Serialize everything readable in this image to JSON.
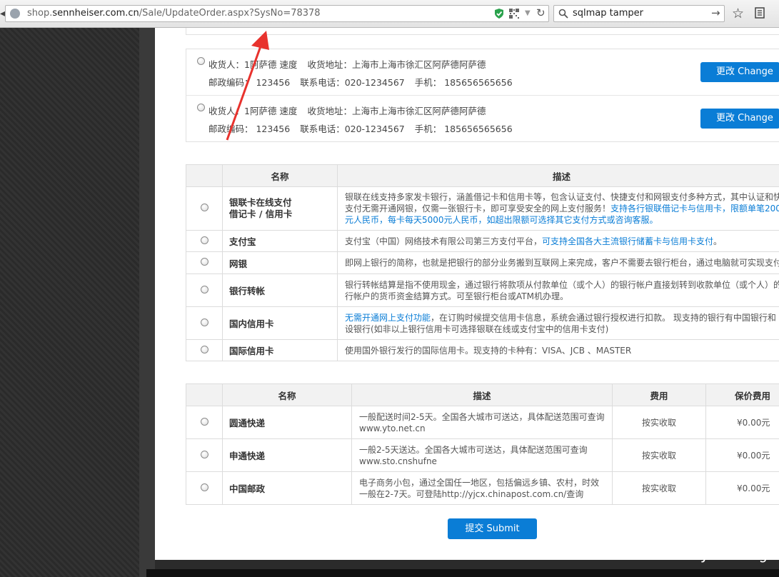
{
  "browser": {
    "url_prefix": "shop.",
    "url_domain": "sennheiser.com.cn",
    "url_path": "/Sale/UpdateOrder.aspx?SysNo=78378",
    "search_query": "sqlmap tamper"
  },
  "addresses": [
    {
      "line1_a": "收货人：1阿萨德 速度",
      "line1_b": "收货地址：上海市上海市徐汇区阿萨德阿萨德",
      "zip": "邮政编码：  123456",
      "phone": "联系电话：020-1234567",
      "mobile": "手机：  185656565656",
      "button": "更改 Change"
    },
    {
      "line1_a": "收货人：1阿萨德 速度",
      "line1_b": "收货地址：上海市上海市徐汇区阿萨德阿萨德",
      "zip": "邮政编码：  123456",
      "phone": "联系电话：020-1234567",
      "mobile": "手机：  185656565656",
      "button": "更改 Change"
    }
  ],
  "payment": {
    "headers": [
      "名称",
      "描述"
    ],
    "rows": [
      {
        "name_1": "银联卡在线支付",
        "name_2": "借记卡 / 信用卡",
        "d1": "银联在线支持多家发卡银行，涵盖借记卡和信用卡等，包含认证支付、快捷支付和网银支付多种方式，其中认证和快",
        "d2a": "支付无需开通网银，仅需一张银行卡，即可享受安全的网上支付服务！",
        "d2b": "支持各行银联借记卡与信用卡，限额单笔200",
        "d3": "元人民币，每卡每天5000元人民币，如超出限额可选择其它支付方式或咨询客服。"
      },
      {
        "name_1": "支付宝",
        "d1a": "支付宝（中国）网络技术有限公司第三方支付平台，",
        "d1b": "可支持全国各大主流银行储蓄卡与信用卡支付",
        "d1c": "。"
      },
      {
        "name_1": "网银",
        "d1": "即网上银行的简称，也就是把银行的部分业务搬到互联网上来完成，客户不需要去银行柜台，通过电脑就可实现支付"
      },
      {
        "name_1": "银行转帐",
        "d1": "银行转帐结算是指不使用现金，通过银行将款项从付款单位（或个人）的银行帐户直接划转到收款单位（或个人）的",
        "d2": "行帐户的货币资金结算方式。可至银行柜台或ATM机办理。"
      },
      {
        "name_1": "国内信用卡",
        "d1a": "无需开通网上支付功能",
        "d1b": "，在订购时候提交信用卡信息，系统会通过银行授权进行扣款。 现支持的银行有中国银行和",
        "d2": "设银行(如非以上银行信用卡可选择银联在线或支付宝中的信用卡支付)"
      },
      {
        "name_1": "国际信用卡",
        "d1": "使用国外银行发行的国际信用卡。现支持的卡种有：VISA、JCB 、MASTER"
      }
    ]
  },
  "shipping": {
    "headers": [
      "名称",
      "描述",
      "费用",
      "保价费用"
    ],
    "rows": [
      {
        "name": "圆通快递",
        "d1": "一般配送时间2-5天。全国各大城市可送达，具体配送范围可查询",
        "d2": "www.yto.net.cn",
        "fee": "按实收取",
        "insure": "¥0.00元"
      },
      {
        "name": "申通快递",
        "d1": "一般2-5天送达。全国各大城市可送达，具体配送范围可查询",
        "d2": "www.sto.cnshufne",
        "fee": "按实收取",
        "insure": "¥0.00元"
      },
      {
        "name": "中国邮政",
        "d1": "电子商务小包，通过全国任一地区，包括偏远乡镇、农村，时效",
        "d2": "一般在2-7天。可登陆http://yjcx.chinapost.com.cn/查询",
        "fee": "按实收取",
        "insure": "¥0.00元"
      }
    ]
  },
  "submit_label": "提交 Submit",
  "watermark": "www.wooyun.org",
  "colors": {
    "accent": "#0a7dd6",
    "annotation_arrow": "#e8322d"
  }
}
